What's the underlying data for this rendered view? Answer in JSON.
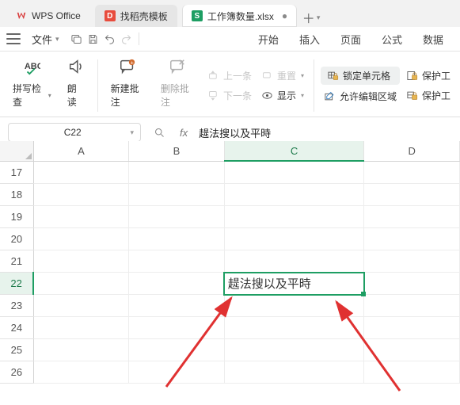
{
  "tabs": {
    "app": {
      "label": "WPS Office"
    },
    "docer": {
      "label": "找稻壳模板",
      "sheet_badge": "D"
    },
    "doc": {
      "label": "工作簿数量.xlsx",
      "sheet_badge": "S"
    }
  },
  "menubar": {
    "file": "文件",
    "items": [
      "开始",
      "插入",
      "页面",
      "公式",
      "数据"
    ]
  },
  "ribbon": {
    "spellcheck": "拼写检查",
    "read_aloud": "朗读",
    "new_comment": "新建批注",
    "del_comment": "删除批注",
    "prev": "上一条",
    "next": "下一条",
    "reset": "重置",
    "show": "显示",
    "lock_cell": "锁定单元格",
    "allow_edit": "允许编辑区域",
    "protect": "保护工"
  },
  "formula_bar": {
    "name": "C22",
    "value": "趧法搜以及平時"
  },
  "grid": {
    "columns": [
      "A",
      "B",
      "C",
      "D"
    ],
    "rows": [
      17,
      18,
      19,
      20,
      21,
      22,
      23,
      24,
      25,
      26
    ],
    "active_col": "C",
    "active_row": 22,
    "active_val": "趧法搜以及平時"
  }
}
